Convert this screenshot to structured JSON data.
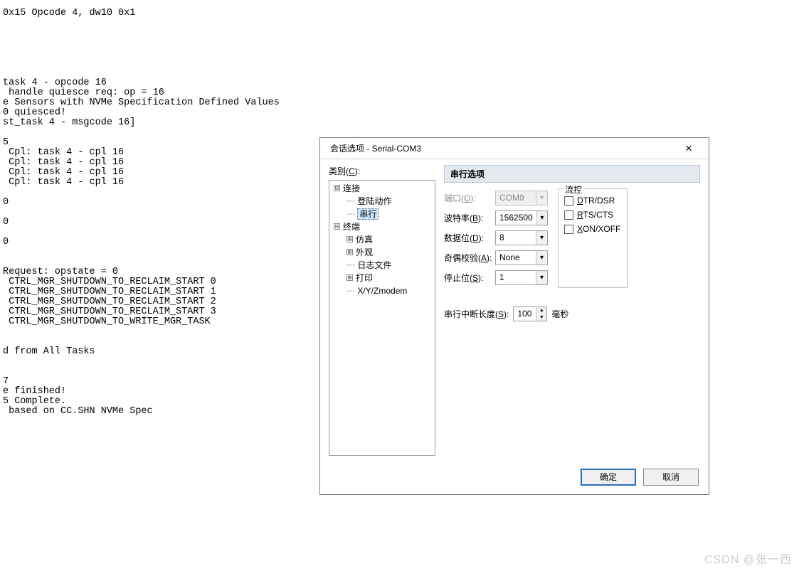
{
  "terminal": {
    "lines": [
      "0x15 Opcode 4, dw10 0x1",
      "",
      "",
      "",
      "",
      "",
      "",
      "task 4 - opcode 16",
      " handle quiesce req: op = 16",
      "e Sensors with NVMe Specification Defined Values",
      "0 quiesced!",
      "st_task 4 - msgcode 16]",
      "",
      "5",
      " Cpl: task 4 - cpl 16",
      " Cpl: task 4 - cpl 16",
      " Cpl: task 4 - cpl 16",
      " Cpl: task 4 - cpl 16",
      "",
      "0",
      "",
      "0",
      "",
      "0",
      "",
      "",
      "Request: opstate = 0",
      " CTRL_MGR_SHUTDOWN_TO_RECLAIM_START 0",
      " CTRL_MGR_SHUTDOWN_TO_RECLAIM_START 1",
      " CTRL_MGR_SHUTDOWN_TO_RECLAIM_START 2",
      " CTRL_MGR_SHUTDOWN_TO_RECLAIM_START 3",
      " CTRL_MGR_SHUTDOWN_TO_WRITE_MGR_TASK",
      "",
      "",
      "d from All Tasks",
      "",
      "",
      "7",
      "e finished!",
      "5 Complete.",
      " based on CC.SHN NVMe Spec"
    ]
  },
  "dialog": {
    "title": "会话选项 - Serial-COM3",
    "close_glyph": "×",
    "category_label_pre": "类别(",
    "category_label_u": "C",
    "category_label_post": "):",
    "tree": {
      "n0": {
        "expander": "⊟",
        "label": "连接"
      },
      "n0a": {
        "label": "登陆动作"
      },
      "n0b": {
        "label": "串行"
      },
      "n1": {
        "expander": "⊟",
        "label": "终端"
      },
      "n1a": {
        "expander": "⊞",
        "label": "仿真"
      },
      "n1b": {
        "expander": "⊞",
        "label": "外观"
      },
      "n1c": {
        "label": "日志文件"
      },
      "n1d": {
        "expander": "⊞",
        "label": "打印"
      },
      "n1e": {
        "label": "X/Y/Zmodem"
      }
    },
    "panel_header": "串行选项",
    "form": {
      "port_label": "端口(O):",
      "port_value": "COM9",
      "baud_label": "波特率(B):",
      "baud_value": "1562500",
      "data_label": "数据位(D):",
      "data_value": "8",
      "parity_label": "奇偶校验(A):",
      "parity_value": "None",
      "stop_label": "停止位(S):",
      "stop_value": "1"
    },
    "flowctrl": {
      "legend": "流控",
      "opt1": "DTR/DSR",
      "opt1_u": "D",
      "opt2": "RTS/CTS",
      "opt2_u": "R",
      "opt3": "XON/XOFF",
      "opt3_u": "X"
    },
    "break_label": "串行中断长度(S):",
    "break_value": "100",
    "break_unit": "毫秒",
    "spin_up": "▲",
    "spin_down": "▼",
    "ok_label": "确定",
    "cancel_label": "取消"
  },
  "watermark": "CSDN @张一西"
}
